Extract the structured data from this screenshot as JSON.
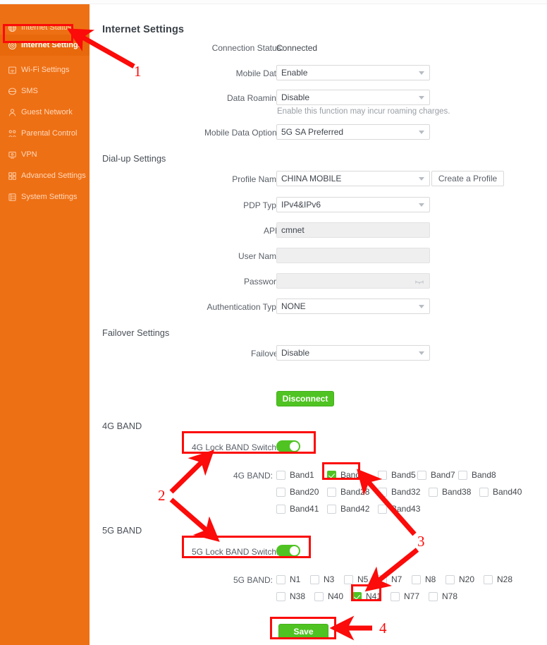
{
  "sidebar": {
    "items": [
      {
        "label": "Internet Status",
        "icon": "globe-icon",
        "active": false
      },
      {
        "label": "Internet Settings",
        "icon": "settings-icon",
        "active": true
      },
      {
        "label": "Wi-Fi Settings",
        "icon": "wifi-icon",
        "active": false
      },
      {
        "label": "SMS",
        "icon": "sms-icon",
        "active": false
      },
      {
        "label": "Guest Network",
        "icon": "user-icon",
        "active": false
      },
      {
        "label": "Parental Control",
        "icon": "family-icon",
        "active": false
      },
      {
        "label": "VPN",
        "icon": "vpn-icon",
        "active": false
      },
      {
        "label": "Advanced Settings",
        "icon": "grid-icon",
        "active": false
      },
      {
        "label": "System Settings",
        "icon": "system-icon",
        "active": false
      }
    ]
  },
  "page": {
    "title": "Internet Settings"
  },
  "connection": {
    "status_label": "Connection Status:",
    "status_value": "Connected",
    "mobile_data_label": "Mobile Data:",
    "mobile_data_value": "Enable",
    "data_roaming_label": "Data Roaming:",
    "data_roaming_value": "Disable",
    "data_roaming_hint": "Enable this function may incur roaming charges.",
    "mobile_data_options_label": "Mobile Data Options:",
    "mobile_data_options_value": "5G SA Preferred"
  },
  "dialup": {
    "section_title": "Dial-up Settings",
    "profile_name_label": "Profile Name:",
    "profile_name_value": "CHINA MOBILE",
    "create_profile_label": "Create a Profile",
    "pdp_type_label": "PDP Type:",
    "pdp_type_value": "IPv4&IPv6",
    "apn_label": "APN:",
    "apn_value": "cmnet",
    "user_name_label": "User Name:",
    "user_name_value": "",
    "password_label": "Password:",
    "password_value": "",
    "auth_type_label": "Authentication Type:",
    "auth_type_value": "NONE"
  },
  "failover": {
    "section_title": "Failover Settings",
    "failover_label": "Failover:",
    "failover_value": "Disable"
  },
  "actions": {
    "disconnect_label": "Disconnect",
    "save_label": "Save"
  },
  "band4g": {
    "section_title": "4G BAND",
    "lock_switch_label": "4G Lock BAND Switch:",
    "lock_switch_on": true,
    "list_label": "4G BAND:",
    "rows": [
      [
        {
          "label": "Band1",
          "checked": false
        },
        {
          "label": "Band3",
          "checked": true
        },
        {
          "label": "Band5",
          "checked": false
        },
        {
          "label": "Band7",
          "checked": false
        },
        {
          "label": "Band8",
          "checked": false
        }
      ],
      [
        {
          "label": "Band20",
          "checked": false
        },
        {
          "label": "Band28",
          "checked": false
        },
        {
          "label": "Band32",
          "checked": false
        },
        {
          "label": "Band38",
          "checked": false
        },
        {
          "label": "Band40",
          "checked": false
        }
      ],
      [
        {
          "label": "Band41",
          "checked": false
        },
        {
          "label": "Band42",
          "checked": false
        },
        {
          "label": "Band43",
          "checked": false
        }
      ]
    ]
  },
  "band5g": {
    "section_title": "5G BAND",
    "lock_switch_label": "5G Lock BAND Switch:",
    "lock_switch_on": true,
    "list_label": "5G BAND:",
    "rows": [
      [
        {
          "label": "N1",
          "checked": false
        },
        {
          "label": "N3",
          "checked": false
        },
        {
          "label": "N5",
          "checked": false
        },
        {
          "label": "N7",
          "checked": false
        },
        {
          "label": "N8",
          "checked": false
        },
        {
          "label": "N20",
          "checked": false
        },
        {
          "label": "N28",
          "checked": false
        }
      ],
      [
        {
          "label": "N38",
          "checked": false
        },
        {
          "label": "N40",
          "checked": false
        },
        {
          "label": "N41",
          "checked": true
        },
        {
          "label": "N77",
          "checked": false
        },
        {
          "label": "N78",
          "checked": false
        }
      ]
    ]
  },
  "annotations": {
    "numbers": [
      "1",
      "2",
      "3",
      "4"
    ]
  },
  "colors": {
    "sidebar": "#ee7014",
    "sidebar_active": "#e8690b",
    "green": "#4fc322",
    "annotation_red": "#fb0b09"
  }
}
